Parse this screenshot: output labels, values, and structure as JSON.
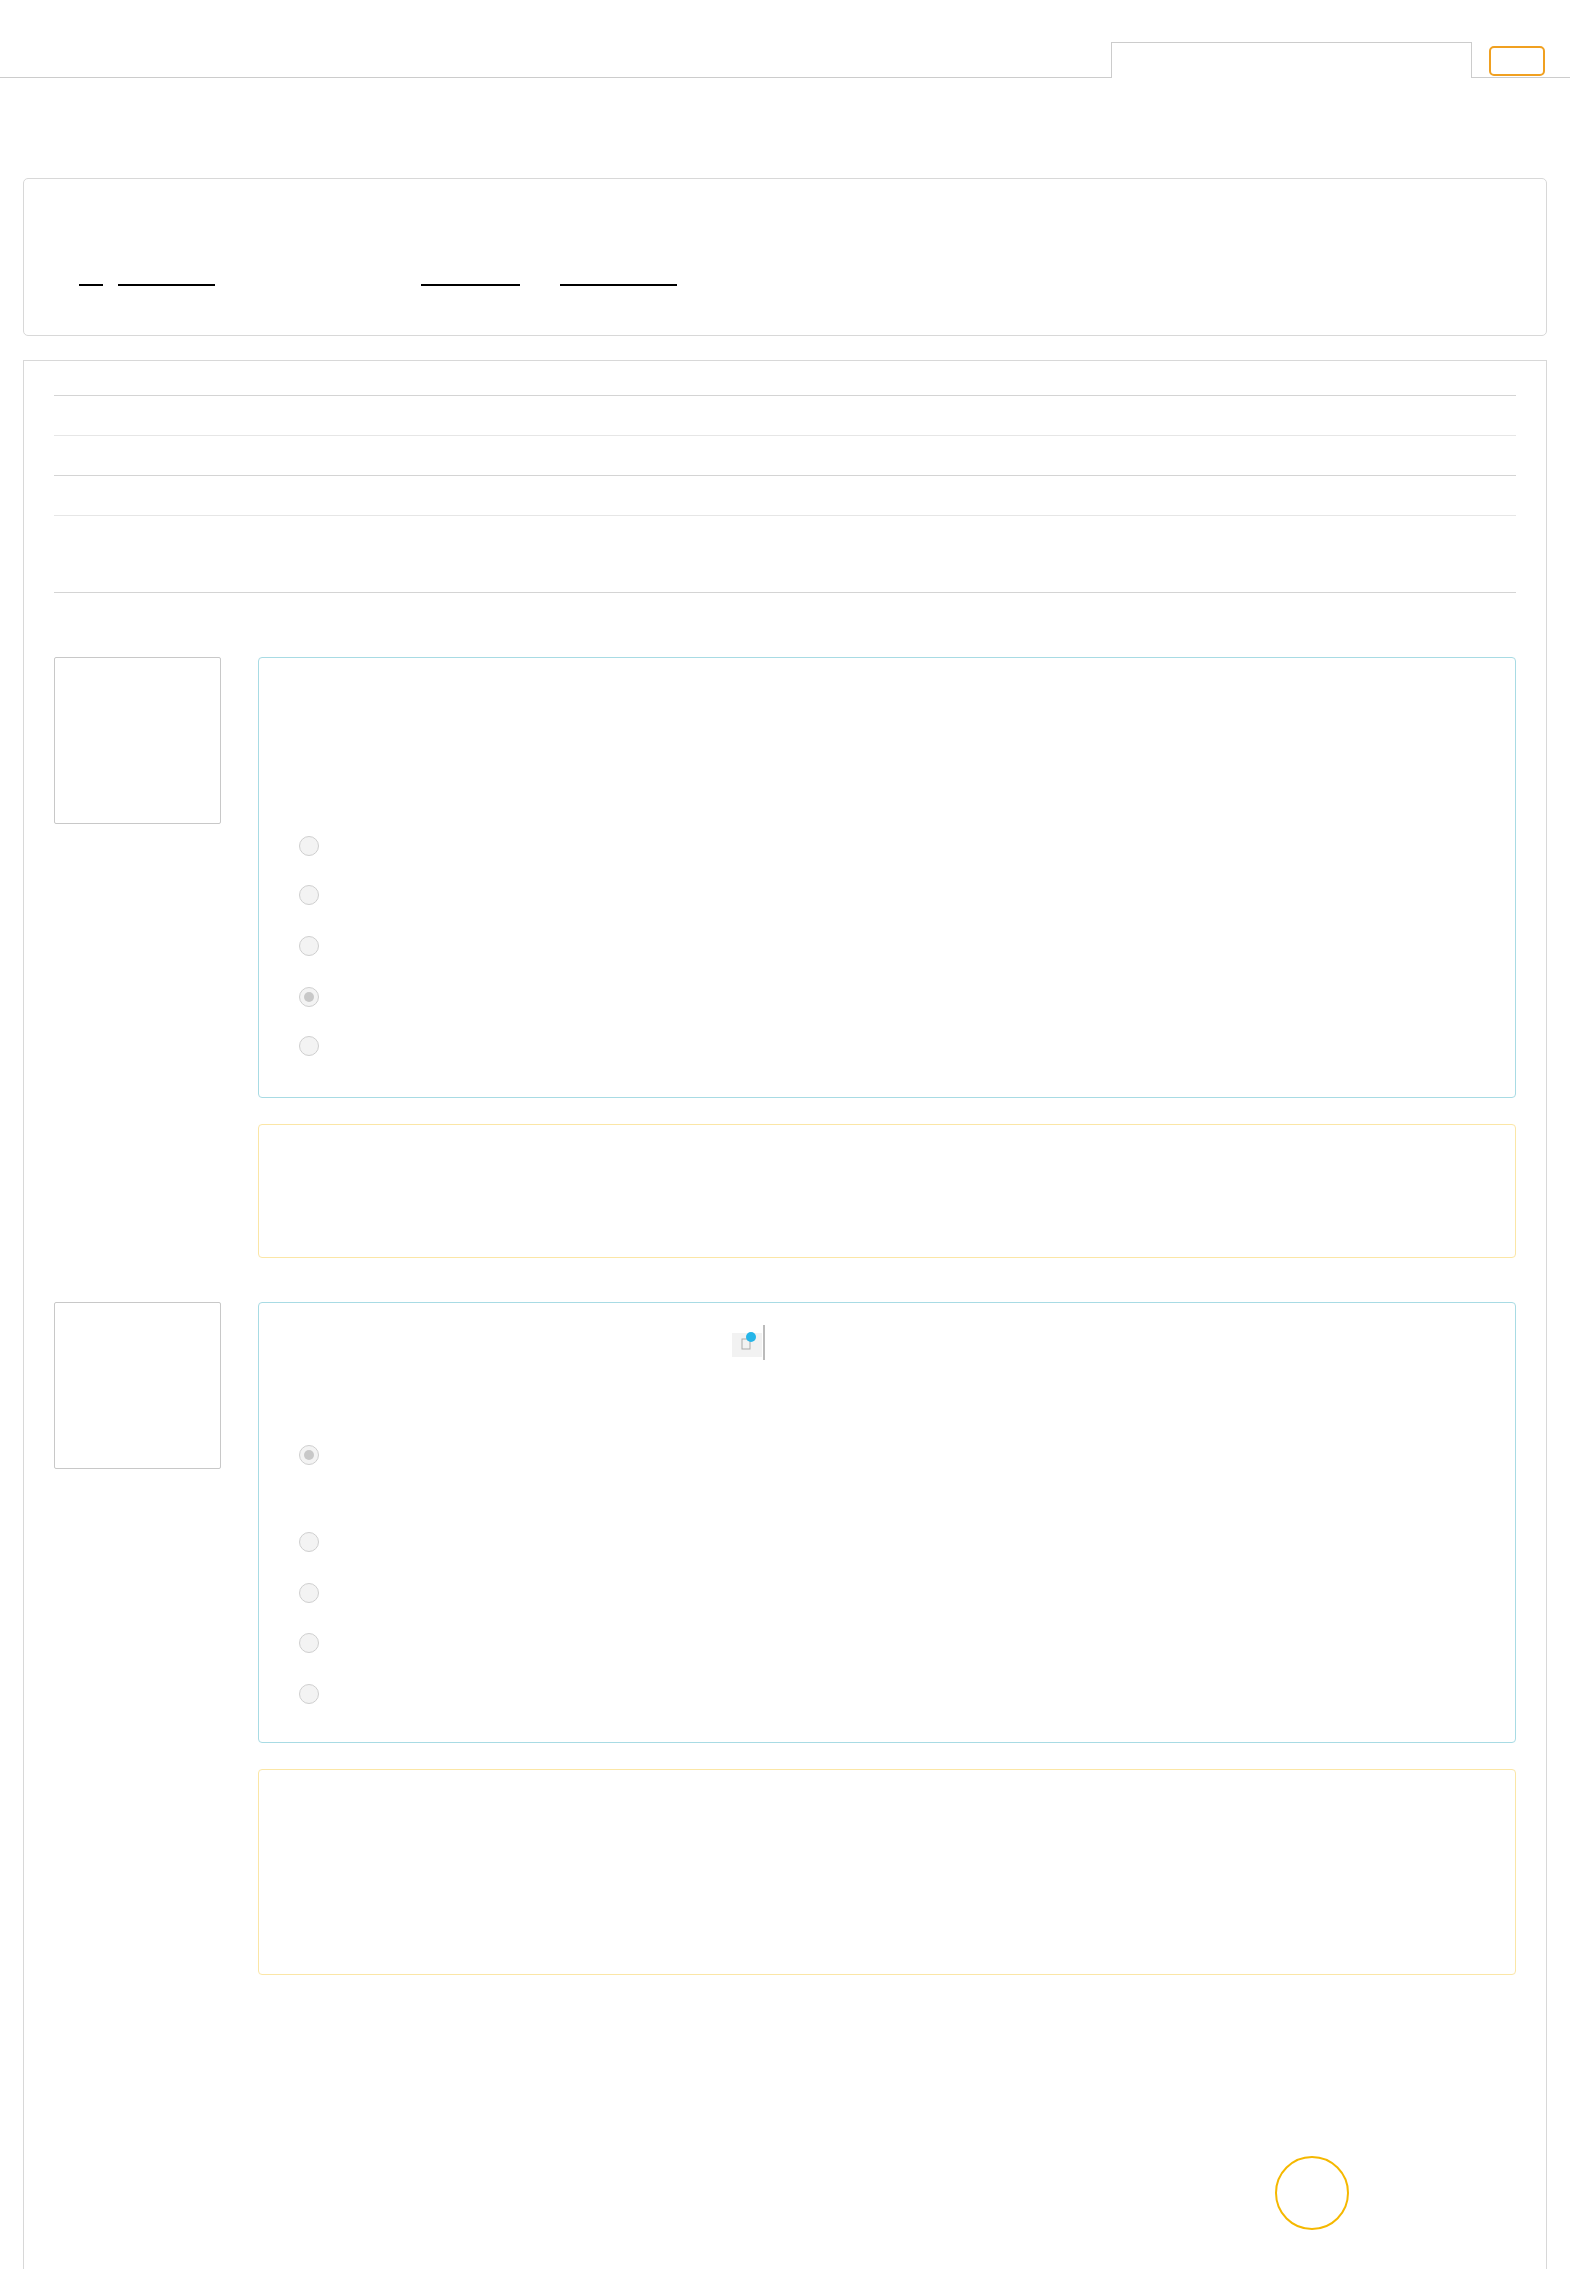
{
  "questions": [
    {
      "options": [
        {
          "selected": false
        },
        {
          "selected": false
        },
        {
          "selected": false
        },
        {
          "selected": true
        },
        {
          "selected": false
        }
      ]
    },
    {
      "has_attachment": true,
      "options": [
        {
          "selected": true
        },
        {
          "selected": false
        },
        {
          "selected": false
        },
        {
          "selected": false
        },
        {
          "selected": false
        }
      ]
    }
  ]
}
